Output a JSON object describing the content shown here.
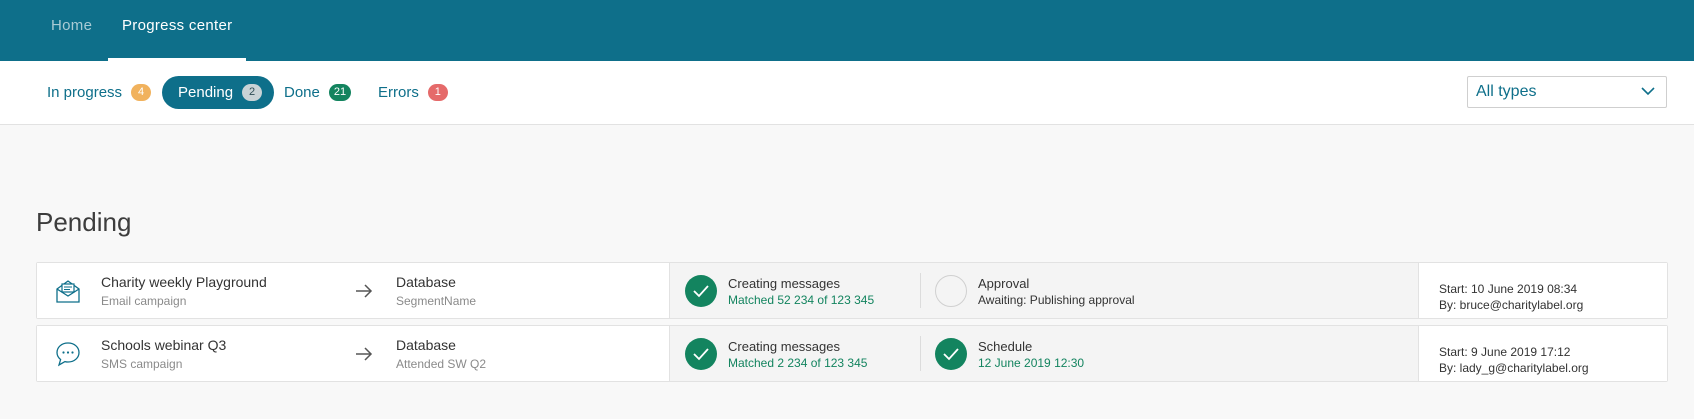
{
  "topnav": {
    "tabs": [
      {
        "label": "Home",
        "active": false
      },
      {
        "label": "Progress center",
        "active": true
      }
    ]
  },
  "filters": {
    "tabs": [
      {
        "label": "In progress",
        "count": "4",
        "color": "#f1b25d",
        "active": false
      },
      {
        "label": "Pending",
        "count": "2",
        "color": "#c9d3d6",
        "active": true
      },
      {
        "label": "Done",
        "count": "21",
        "color": "#13845f",
        "active": false
      },
      {
        "label": "Errors",
        "count": "1",
        "color": "#e56a6a",
        "active": false
      }
    ],
    "type_select": {
      "value": "All types",
      "icon": "chevron-down-icon"
    }
  },
  "section": {
    "title": "Pending"
  },
  "items": [
    {
      "icon": "email-icon",
      "name": "Charity weekly Playground",
      "type": "Email campaign",
      "target_title": "Database",
      "target_sub": "SegmentName",
      "step1": {
        "status": "done",
        "title": "Creating messages",
        "detail": "Matched 52 234 of 123 345"
      },
      "step2": {
        "status": "pending",
        "title": "Approval",
        "detail": "Awaiting: Publishing approval"
      },
      "start": "Start: 10 June 2019 08:34",
      "by": "By: bruce@charitylabel.org"
    },
    {
      "icon": "sms-icon",
      "name": "Schools webinar Q3",
      "type": "SMS campaign",
      "target_title": "Database",
      "target_sub": "Attended SW Q2",
      "step1": {
        "status": "done",
        "title": "Creating messages",
        "detail": "Matched 2 234 of 123 345"
      },
      "step2": {
        "status": "done",
        "title": "Schedule",
        "detail": "12 June 2019 12:30"
      },
      "start": "Start: 9 June 2019 17:12",
      "by": "By: lady_g@charitylabel.org"
    }
  ],
  "colors": {
    "brand": "#0e6f8a",
    "success": "#13845f",
    "warning": "#f1b25d",
    "error": "#e56a6a"
  }
}
